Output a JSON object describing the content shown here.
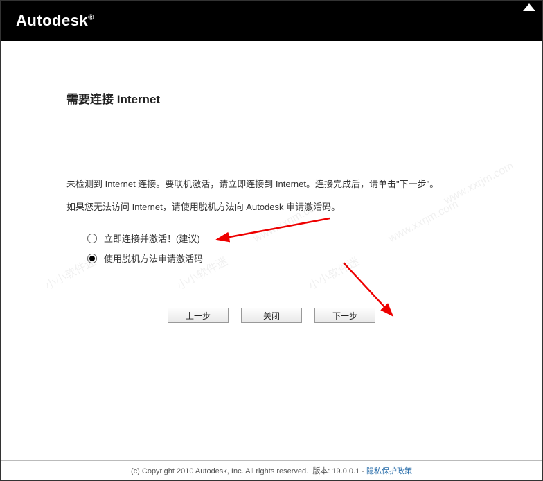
{
  "header": {
    "brand": "Autodesk"
  },
  "page": {
    "title": "需要连接 Internet",
    "paragraph1": "未检测到 Internet 连接。要联机激活，请立即连接到 Internet。连接完成后，请单击\"下一步\"。",
    "paragraph2": "如果您无法访问 Internet，请使用脱机方法向 Autodesk 申请激活码。"
  },
  "options": [
    {
      "label": "立即连接并激活！(建议)",
      "checked": false
    },
    {
      "label": "使用脱机方法申请激活码",
      "checked": true
    }
  ],
  "buttons": {
    "back": "上一步",
    "close": "关闭",
    "next": "下一步"
  },
  "footer": {
    "copyright": "(c) Copyright 2010 Autodesk, Inc. All rights reserved.",
    "version_label": "版本:",
    "version_value": "19.0.0.1",
    "link": "隐私保护政策"
  },
  "watermarks": {
    "text1": "小小软件迷",
    "text2": "www.xxrjm.com"
  }
}
